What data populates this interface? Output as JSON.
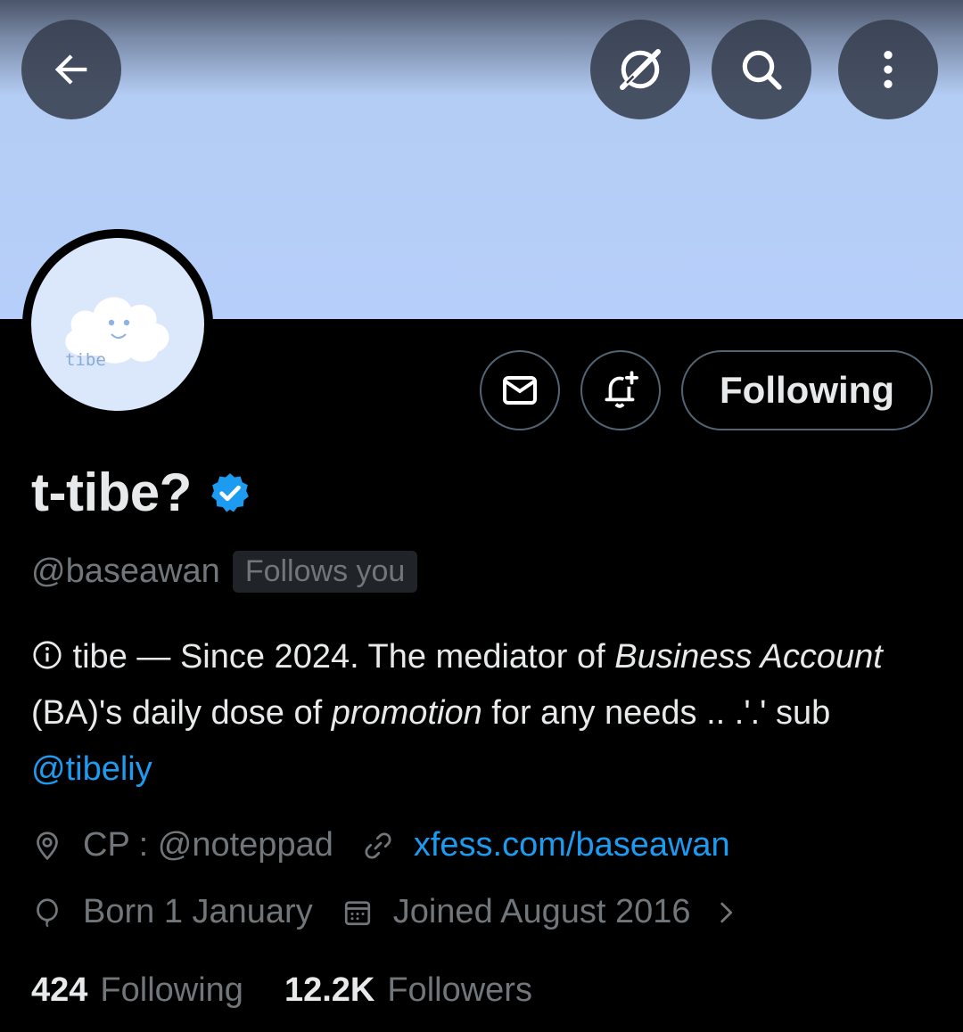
{
  "header": {
    "banner_colors": [
      "#4a5568",
      "#b6cffa"
    ],
    "back_icon": "arrow-left-icon",
    "grok_icon": "grok-icon",
    "search_icon": "search-icon",
    "more_icon": "more-vertical-icon"
  },
  "avatar": {
    "text": "tibe",
    "bg": "#dbe8fb"
  },
  "actions": {
    "message_icon": "envelope-icon",
    "notify_icon": "bell-plus-icon",
    "following_label": "Following"
  },
  "profile": {
    "display_name": "t-tibe?",
    "verified_icon": "verified-badge-icon",
    "handle": "@baseawan",
    "follows_you": "Follows you"
  },
  "bio": {
    "part1": " tibe — Since 2024. The mediator of ",
    "em1": "Business Account",
    "part2": " (BA)'s daily dose of ",
    "em2": "promotion",
    "part3": " for any needs .. .'.' sub ",
    "mention": "@tibeliy"
  },
  "meta": {
    "location_icon": "location-pin-icon",
    "location": "CP : @noteppad",
    "link_icon": "link-icon",
    "website": "xfess.com/baseawan",
    "birthday_icon": "balloon-icon",
    "birthday": "Born 1 January",
    "joined_icon": "calendar-icon",
    "joined": "Joined August 2016",
    "expand_icon": "chevron-right-icon"
  },
  "stats": {
    "following_count": "424",
    "following_label": "Following",
    "followers_count": "12.2K",
    "followers_label": "Followers"
  },
  "colors": {
    "accent": "#1d9bf0",
    "muted": "#71767b",
    "text": "#e7e9ea"
  }
}
